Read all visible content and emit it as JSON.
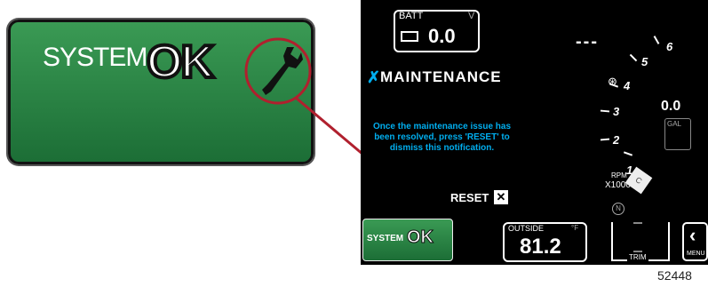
{
  "large_badge": {
    "prefix": "SYSTEM",
    "ok": "OK"
  },
  "battery": {
    "label": "BATT",
    "unit": "V",
    "value": "0.0"
  },
  "speed_readout": "---",
  "maintenance": {
    "title": "MAINTENANCE",
    "message": "Once the maintenance issue has been resolved, press 'RESET' to dismiss this notification.",
    "reset_label": "RESET"
  },
  "tachometer": {
    "unit_label": "RPM",
    "multiplier": "X1000",
    "marks": [
      "1",
      "2",
      "3",
      "4",
      "5",
      "6"
    ],
    "gear": "N"
  },
  "fuel": {
    "value": "0.0",
    "label": "GAL"
  },
  "small_badge": {
    "prefix": "SYSTEM",
    "ok": "OK"
  },
  "outside": {
    "label": "OUTSIDE",
    "unit": "°F",
    "value": "81.2"
  },
  "trim": {
    "label": "TRIM"
  },
  "menu": {
    "label": "MENU"
  },
  "figure_number": "52448",
  "colors": {
    "badge_green": "#2a8a46",
    "accent_cyan": "#00aeef",
    "callout_red": "#b0202e"
  }
}
